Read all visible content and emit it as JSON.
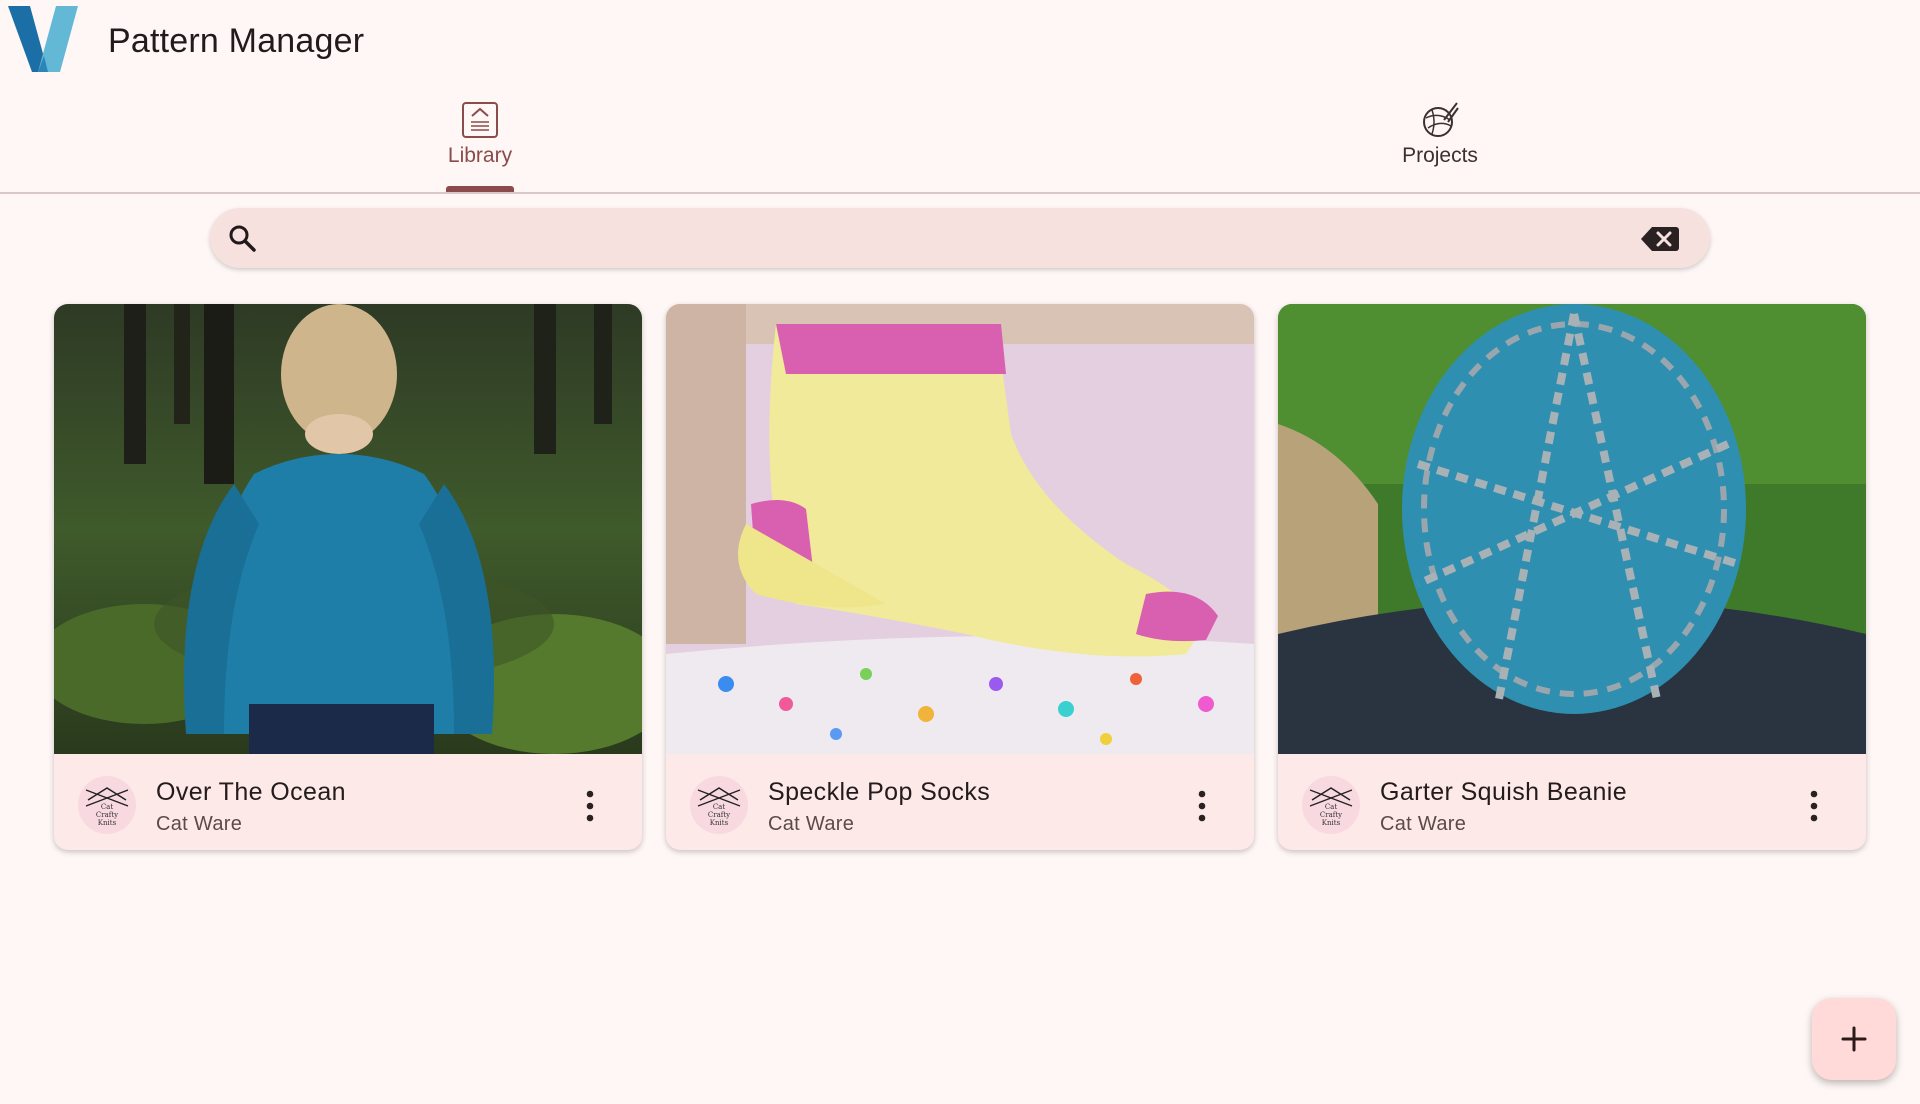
{
  "app": {
    "title": "Pattern Manager",
    "logo_icon": "v-logo"
  },
  "tabs": [
    {
      "label": "Library",
      "icon": "pattern-frame-icon",
      "selected": true
    },
    {
      "label": "Projects",
      "icon": "yarn-ball-icon",
      "selected": false
    }
  ],
  "search": {
    "value": "",
    "placeholder": "",
    "icon": "search-icon",
    "clear_icon": "backspace-icon"
  },
  "patterns": [
    {
      "title": "Over The Ocean",
      "designer": "Cat Ware",
      "photo": "child in blue textured sweater in forest",
      "avatar_text": "Cat Crafty Knits"
    },
    {
      "title": "Speckle Pop Socks",
      "designer": "Cat Ware",
      "photo": "pink and yellow lace ankle sock on confetti",
      "avatar_text": "Cat Crafty Knits"
    },
    {
      "title": "Garter Squish Beanie",
      "designer": "Cat Ware",
      "photo": "blue and grey twisted-stitch beanie",
      "avatar_text": "Cat Crafty Knits"
    }
  ],
  "fab": {
    "icon": "plus-icon"
  },
  "colors": {
    "background": "#fef7f5",
    "accent": "#8c4b4b",
    "search_bg": "#f6e1df",
    "card_bg": "#fde9e7",
    "fab_bg": "#ffdad9"
  }
}
